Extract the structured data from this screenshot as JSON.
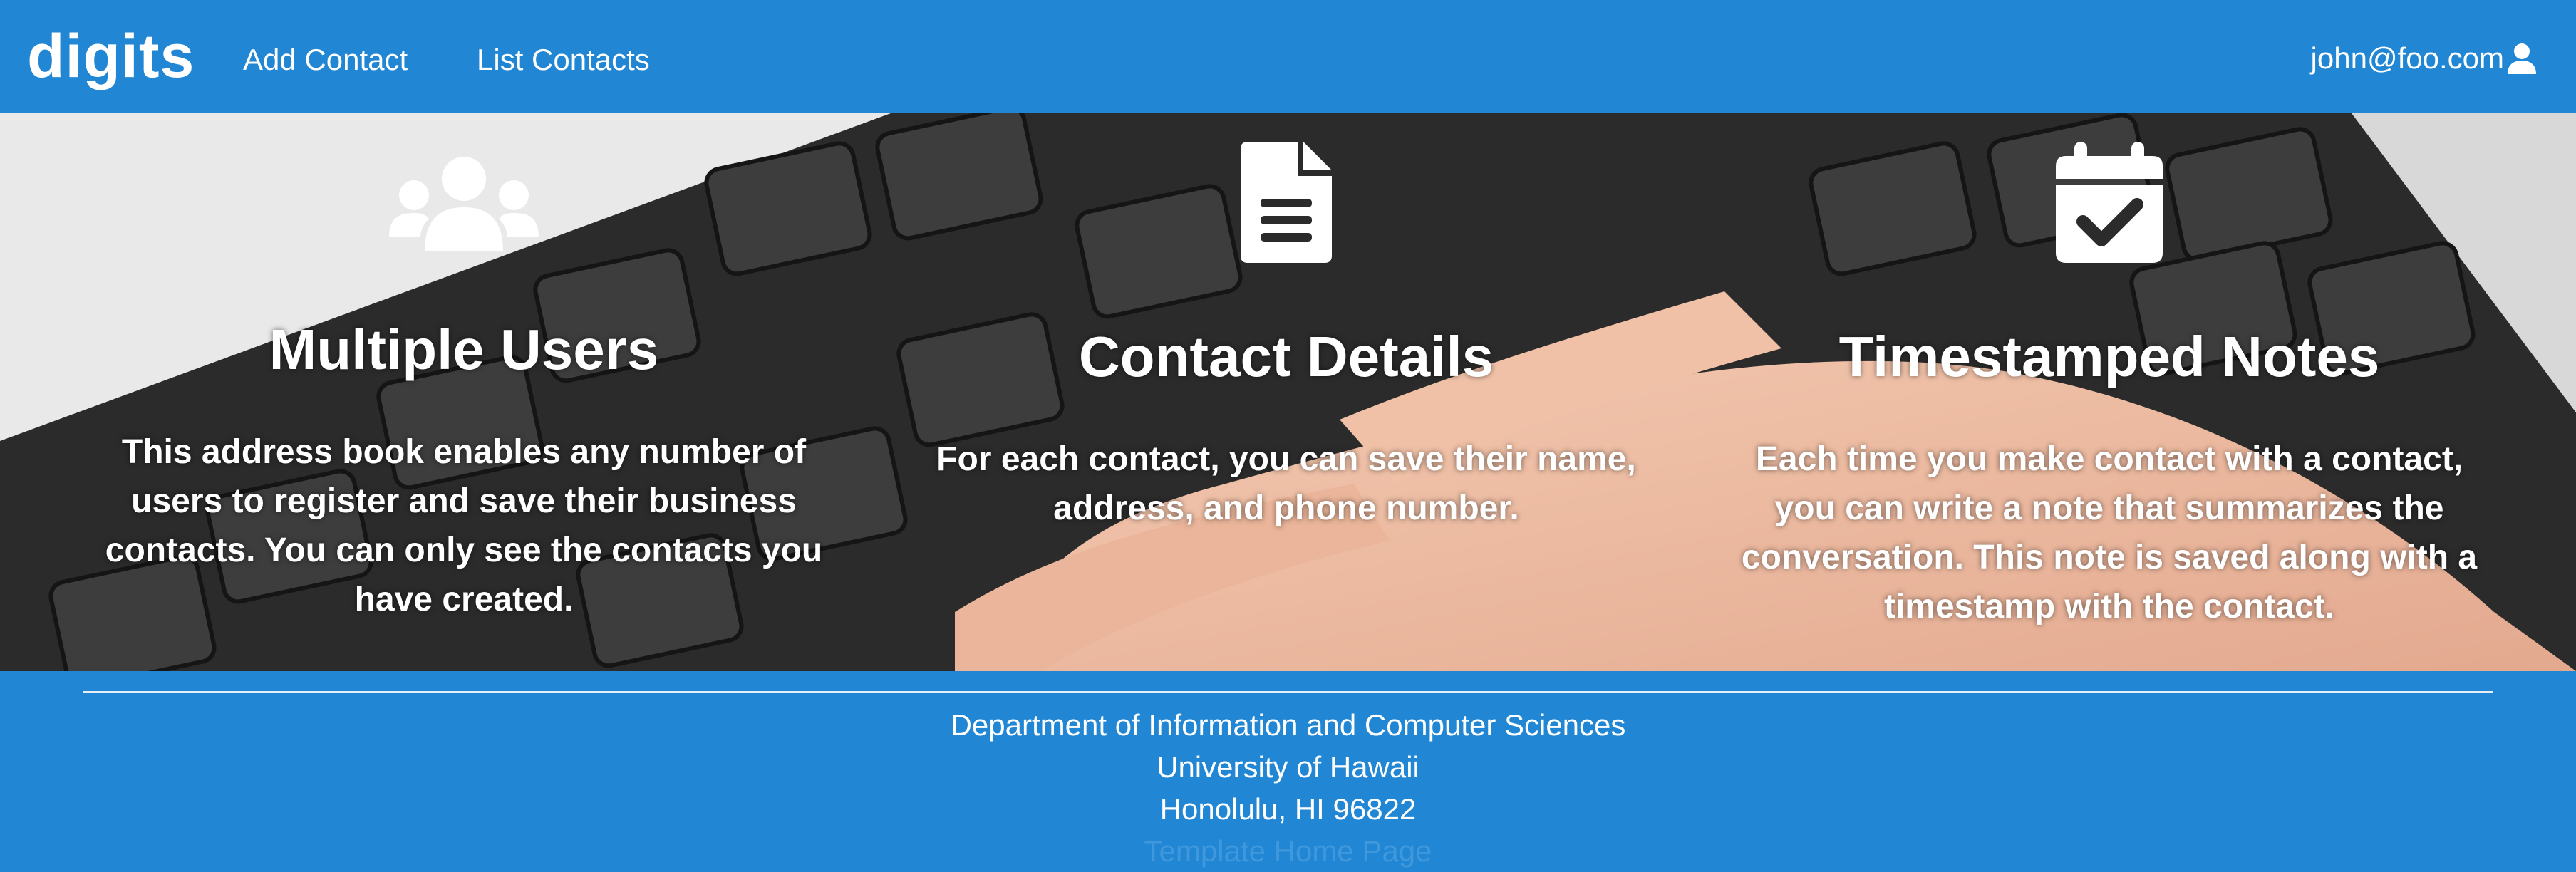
{
  "navbar": {
    "brand": "digits",
    "links": [
      "Add Contact",
      "List Contacts"
    ],
    "user_email": "john@foo.com",
    "user_icon": "user-icon"
  },
  "features": [
    {
      "icon": "users-icon",
      "title": "Multiple Users",
      "lines": [
        "This address book enables any number of",
        "users to register and save their business",
        "contacts. You can only see the contacts you",
        "have created."
      ]
    },
    {
      "icon": "file-text-icon",
      "title": "Contact Details",
      "lines": [
        "For each contact, you can save their name,",
        "address, and phone number."
      ]
    },
    {
      "icon": "calendar-check-icon",
      "title": "Timestamped Notes",
      "lines": [
        "Each time you make contact with a contact,",
        "you can write a note that summarizes the",
        "conversation. This note is saved along with a",
        "timestamp with the contact."
      ]
    }
  ],
  "footer": {
    "lines": [
      "Department of Information and Computer Sciences",
      "University of Hawaii",
      "Honolulu, HI 96822",
      "Template Home Page"
    ]
  },
  "colors": {
    "brand_blue": "#2186d3",
    "text": "#ffffff"
  }
}
